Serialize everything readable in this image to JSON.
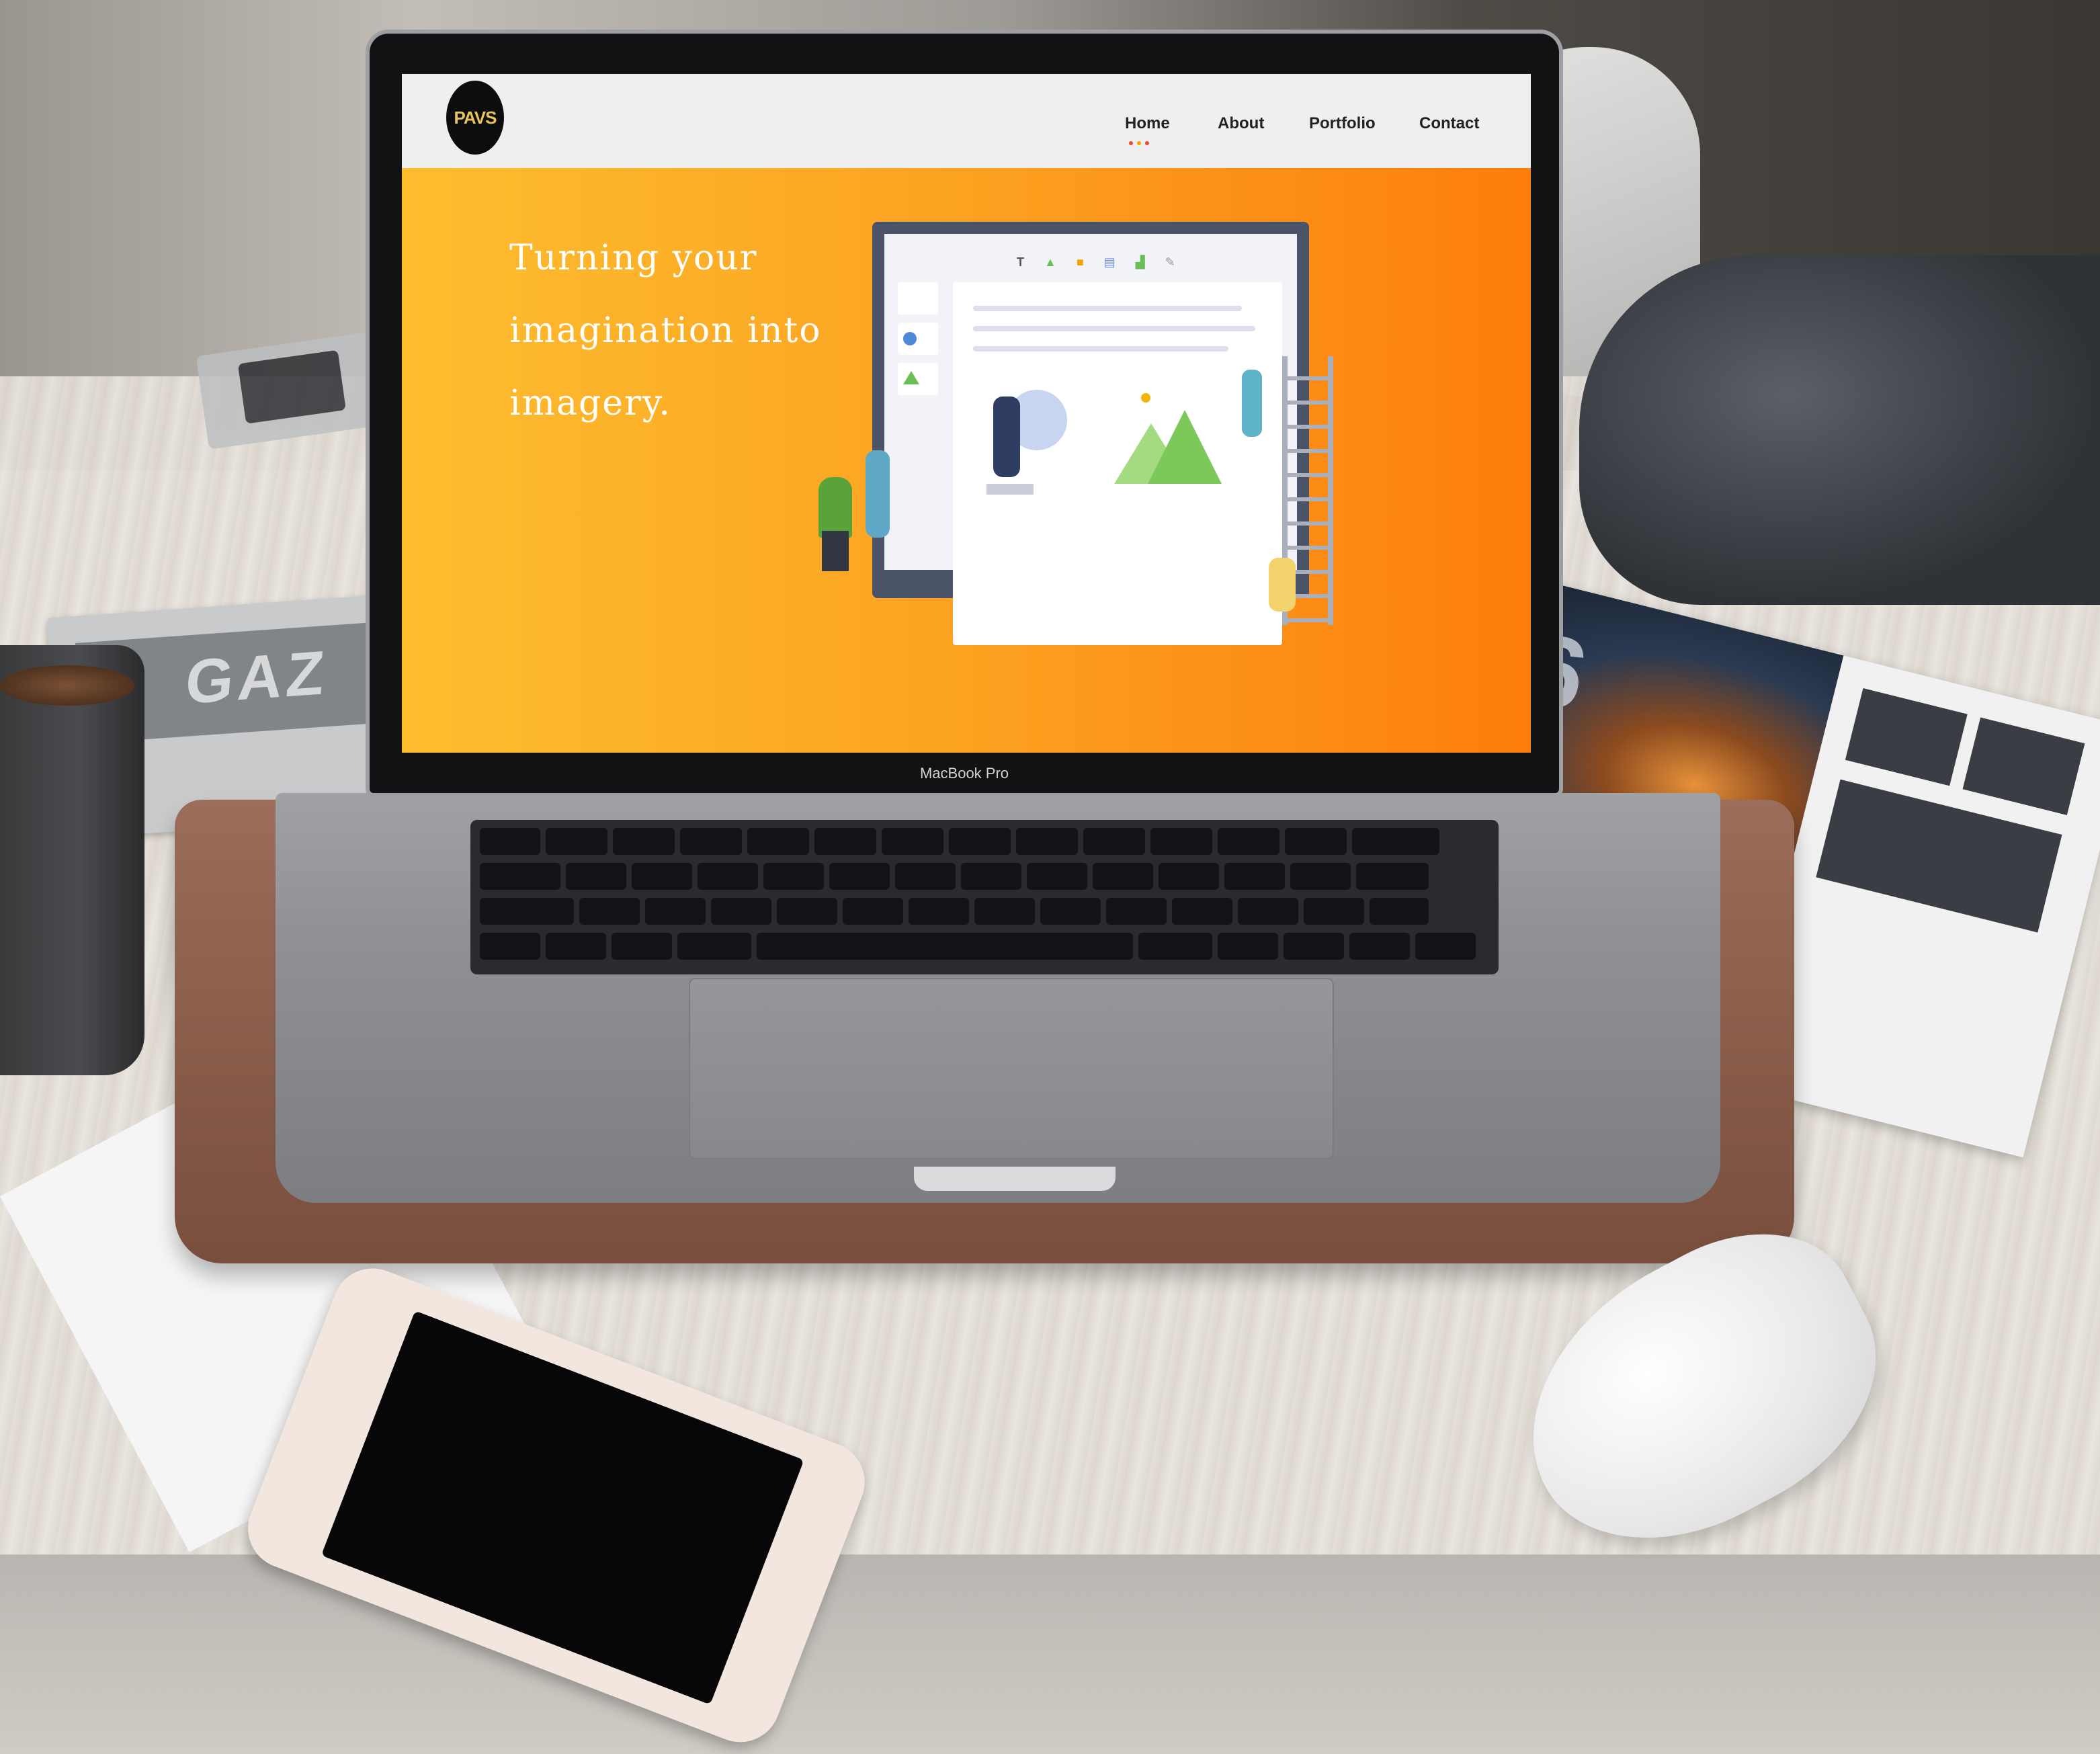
{
  "device": {
    "model_label": "MacBook Pro"
  },
  "website": {
    "logo_text": "PAVS",
    "nav": {
      "items": [
        {
          "label": "Home",
          "active": true
        },
        {
          "label": "About",
          "active": false
        },
        {
          "label": "Portfolio",
          "active": false
        },
        {
          "label": "Contact",
          "active": false
        }
      ],
      "active_indicator_colors": [
        "#e84a3a",
        "#f4a300",
        "#e84a3a"
      ]
    },
    "hero": {
      "headline": "Turning your imagination into imagery.",
      "gradient_colors": [
        "#fdbd2f",
        "#fd7d0b"
      ]
    },
    "illustration": {
      "toolbar_icons": [
        "text-icon",
        "image-icon",
        "document-icon",
        "calendar-icon",
        "chart-icon",
        "edit-icon"
      ]
    }
  },
  "magazine_left": {
    "text": "GAZ"
  },
  "colors": {
    "brand_accent": "#fc9018",
    "nav_background": "#efefef",
    "sleeve": "#8a5c4a"
  }
}
